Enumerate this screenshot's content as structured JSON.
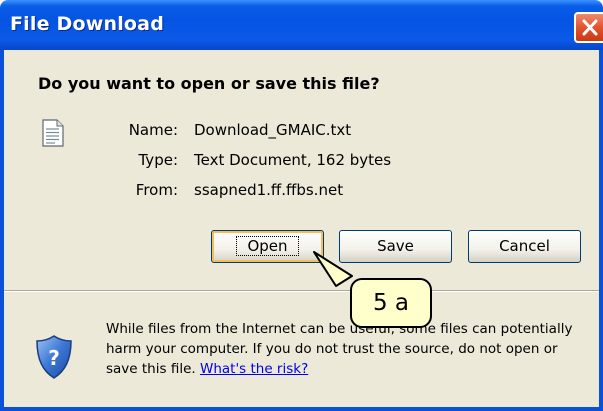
{
  "window": {
    "title": "File Download"
  },
  "dialog": {
    "question": "Do you want to open or save this file?",
    "file_icon": "text-file-icon",
    "info": [
      {
        "label": "Name:",
        "value": "Download_GMAIC.txt"
      },
      {
        "label": "Type:",
        "value": "Text Document, 162 bytes"
      },
      {
        "label": "From:",
        "value": "ssapned1.ff.ffbs.net"
      }
    ],
    "buttons": {
      "open": "Open",
      "save": "Save",
      "cancel": "Cancel"
    },
    "warning_icon": "shield-question-icon",
    "warning_text": "While files from the Internet can be useful, some files can potentially harm your computer. If you do not trust the source, do not open or save this file.",
    "risk_link": "What's the risk?"
  },
  "callout": {
    "label": "5 a"
  },
  "colors": {
    "titlebar": "#0554e3",
    "client_bg": "#ece9d8",
    "close_button": "#e2542d",
    "callout_bg": "#ffffcc",
    "focus_ring": "#f5be57"
  }
}
